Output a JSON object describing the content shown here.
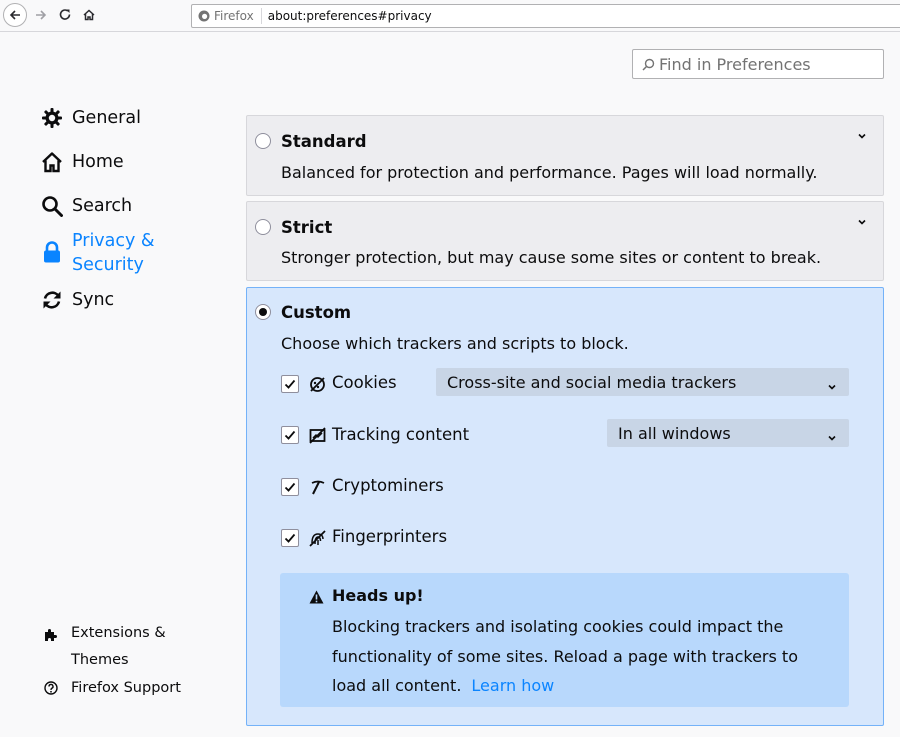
{
  "toolbar": {
    "identity_label": "Firefox",
    "url": "about:preferences#privacy"
  },
  "search": {
    "placeholder": "Find in Preferences"
  },
  "sidebar": {
    "items": [
      {
        "label": "General",
        "icon": "gear-icon"
      },
      {
        "label": "Home",
        "icon": "home-icon"
      },
      {
        "label": "Search",
        "icon": "search-icon"
      },
      {
        "label": "Privacy & Security",
        "icon": "lock-icon",
        "selected": true
      },
      {
        "label": "Sync",
        "icon": "sync-icon"
      }
    ],
    "footer": [
      {
        "label": "Extensions & Themes",
        "icon": "puzzle-icon"
      },
      {
        "label": "Firefox Support",
        "icon": "help-icon"
      }
    ]
  },
  "protection": {
    "standard": {
      "title": "Standard",
      "description": "Balanced for protection and performance. Pages will load normally."
    },
    "strict": {
      "title": "Strict",
      "description": "Stronger protection, but may cause some sites or content to break."
    },
    "custom": {
      "title": "Custom",
      "description": "Choose which trackers and scripts to block.",
      "rows": [
        {
          "label": "Cookies",
          "checked": true,
          "icon": "cookie-icon",
          "dropdown": "Cross-site and social media trackers"
        },
        {
          "label": "Tracking content",
          "checked": true,
          "icon": "tracking-content-icon",
          "dropdown": "In all windows"
        },
        {
          "label": "Cryptominers",
          "checked": true,
          "icon": "cryptominer-icon"
        },
        {
          "label": "Fingerprinters",
          "checked": true,
          "icon": "fingerprint-icon"
        }
      ],
      "warning": {
        "title": "Heads up!",
        "body": "Blocking trackers and isolating cookies could impact the functionality of some sites. Reload a page with trackers to load all content.",
        "link": "Learn how"
      }
    },
    "selected": "custom"
  },
  "colors": {
    "accent": "#0a84ff",
    "custom_card_bg": "#d7e7fc",
    "warning_bg": "#b8d8fc"
  }
}
